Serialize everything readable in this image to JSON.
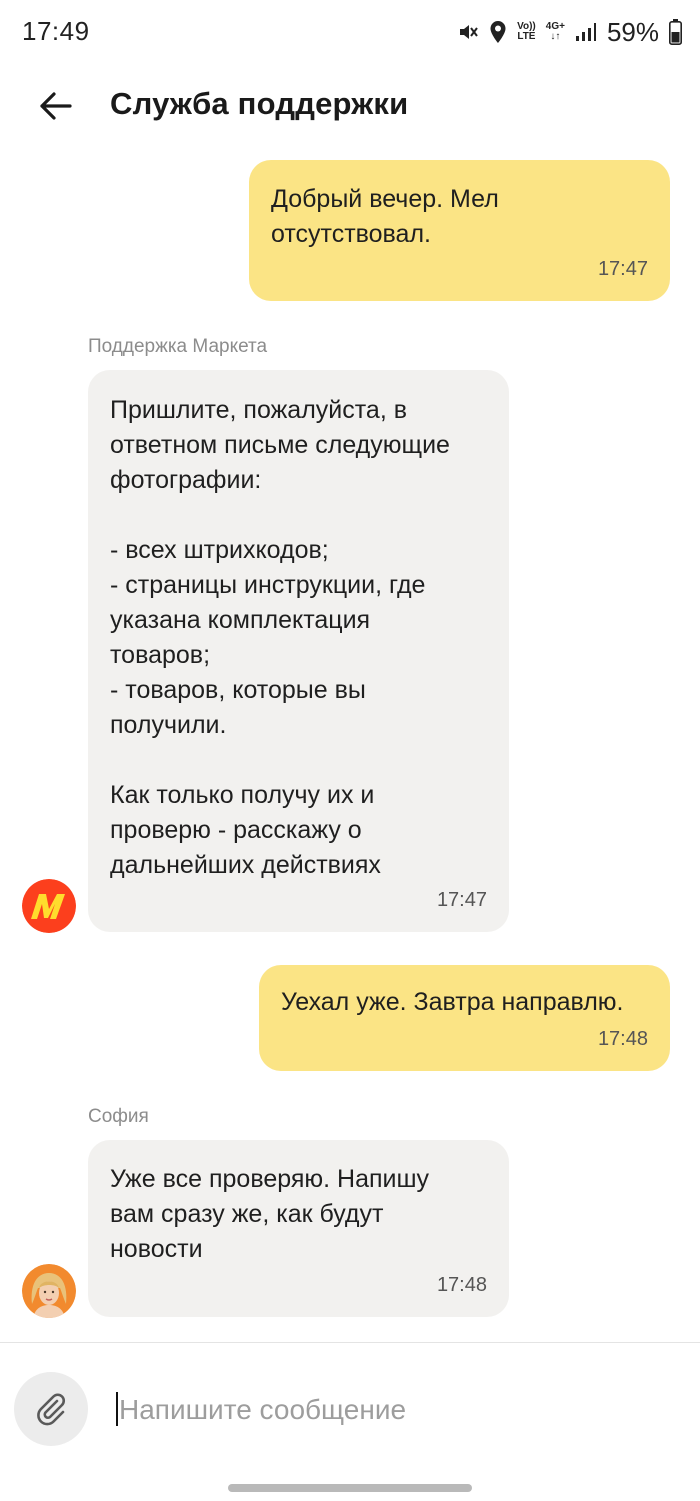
{
  "status_bar": {
    "time": "17:49",
    "volte_top": "Vo))",
    "volte_bottom": "LTE",
    "network": "4G+",
    "battery_percent": "59%"
  },
  "header": {
    "title": "Служба поддержки"
  },
  "messages": [
    {
      "direction": "out",
      "text": "Добрый вечер. Мел\nотсутствовал.",
      "time": "17:47"
    },
    {
      "direction": "in",
      "sender": "Поддержка Маркета",
      "avatar": "market-logo",
      "text": "Пришлите, пожалуйста, в\nответном письме следующие\nфотографии:\n\n- всех штрихкодов;\n- страницы инструкции, где\nуказана комплектация\nтоваров;\n- товаров, которые вы\nполучили.\n\nКак только получу их и\nпроверю - расскажу о\nдальнейших действиях",
      "time": "17:47"
    },
    {
      "direction": "out",
      "text": "Уехал уже. Завтра направлю.",
      "time": "17:48"
    },
    {
      "direction": "in",
      "sender": "София",
      "avatar": "agent-photo",
      "text": "Уже все проверяю. Напишу\nвам сразу же, как будут\nновости",
      "time": "17:48"
    }
  ],
  "composer": {
    "placeholder": "Напишите сообщение",
    "attach_icon": "paperclip-icon"
  },
  "colors": {
    "outgoing_bubble": "#fbe485",
    "incoming_bubble": "#f2f1ef",
    "market_logo_bg": "#fc3f1d",
    "market_logo_fg": "#ffdd2d"
  }
}
